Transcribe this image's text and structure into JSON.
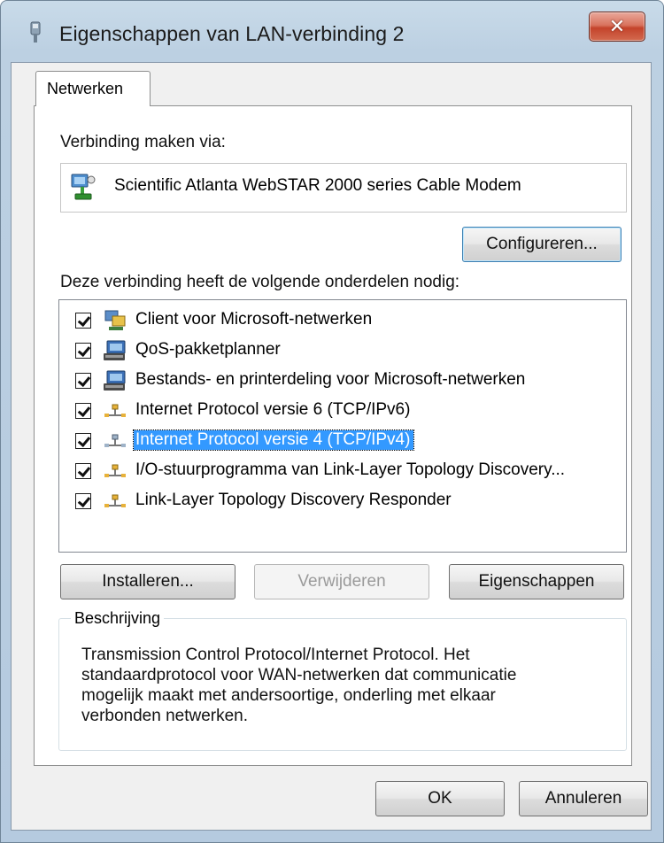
{
  "window": {
    "title": "Eigenschappen van LAN-verbinding 2",
    "close_glyph": "✕",
    "accent_color": "#3399ff"
  },
  "tabs": [
    {
      "label": "Netwerken",
      "active": true
    }
  ],
  "connect_via": {
    "label": "Verbinding maken via:",
    "device": "Scientific Atlanta WebSTAR 2000 series Cable Modem",
    "device_icon": "network-adapter-icon",
    "configure_button": "Configureren..."
  },
  "components": {
    "label": "Deze verbinding heeft de volgende onderdelen nodig:",
    "items": [
      {
        "label": "Client voor Microsoft-netwerken",
        "checked": true,
        "icon": "network-client-icon",
        "selected": false
      },
      {
        "label": "QoS-pakketplanner",
        "checked": true,
        "icon": "network-service-icon",
        "selected": false
      },
      {
        "label": "Bestands- en printerdeling voor Microsoft-netwerken",
        "checked": true,
        "icon": "network-service-icon",
        "selected": false
      },
      {
        "label": "Internet Protocol versie 6 (TCP/IPv6)",
        "checked": true,
        "icon": "protocol-icon",
        "selected": false
      },
      {
        "label": "Internet Protocol versie 4 (TCP/IPv4)",
        "checked": true,
        "icon": "protocol-icon",
        "selected": true
      },
      {
        "label": "I/O-stuurprogramma van Link-Layer Topology Discovery...",
        "checked": true,
        "icon": "protocol-icon",
        "selected": false
      },
      {
        "label": "Link-Layer Topology Discovery Responder",
        "checked": true,
        "icon": "protocol-icon",
        "selected": false
      }
    ]
  },
  "buttons": {
    "install": "Installeren...",
    "remove": "Verwijderen",
    "properties": "Eigenschappen",
    "ok": "OK",
    "cancel": "Annuleren"
  },
  "description": {
    "title": "Beschrijving",
    "text_lines": [
      "Transmission Control Protocol/Internet Protocol. Het",
      "standaardprotocol voor WAN-netwerken dat communicatie",
      "mogelijk maakt met andersoortige, onderling met elkaar",
      "verbonden netwerken."
    ]
  }
}
